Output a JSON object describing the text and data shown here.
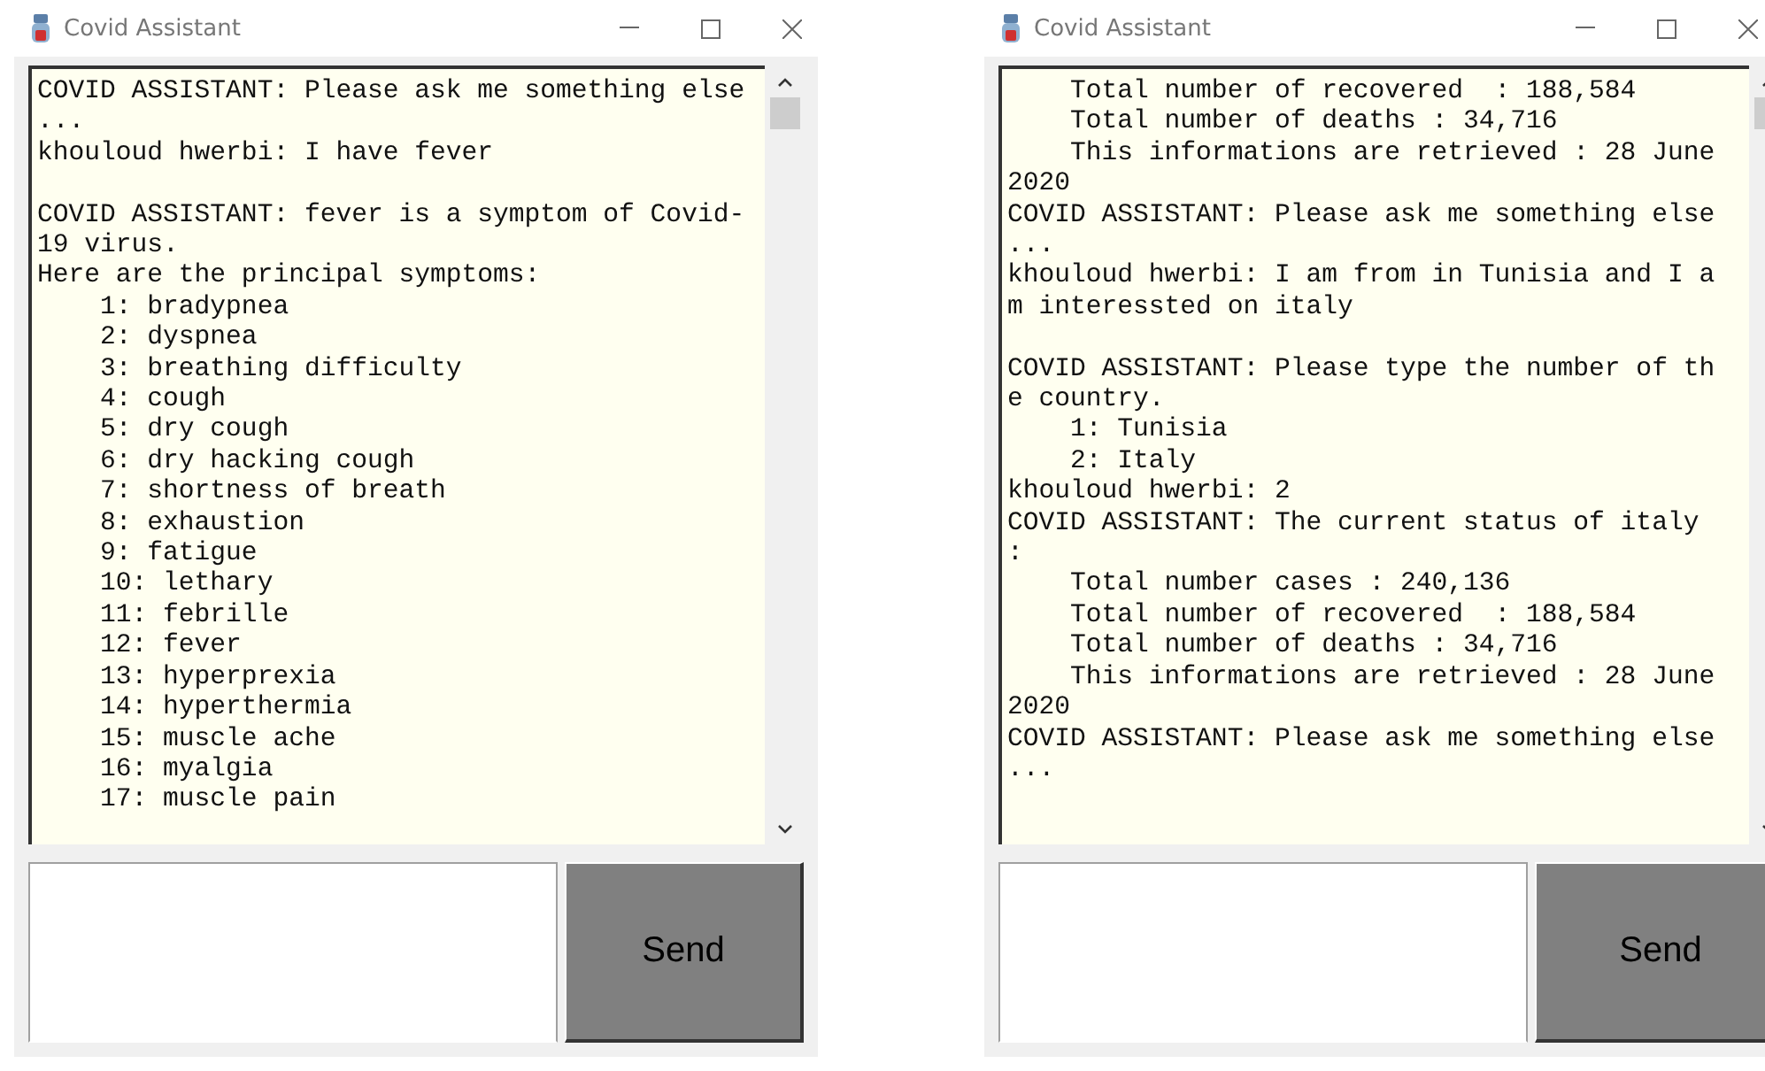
{
  "windows": [
    {
      "title": "Covid Assistant",
      "transcript": [
        {
          "text": "COVID ASSISTANT: Please ask me something else"
        },
        {
          "text": "..."
        },
        {
          "text": "khouloud hwerbi: I have fever"
        },
        {
          "text": "COVID ASSISTANT: fever is a symptom of Covid-",
          "space_before": true
        },
        {
          "text": "19 virus."
        },
        {
          "text": "Here are the principal symptoms:"
        },
        {
          "text": "    1: bradypnea"
        },
        {
          "text": "    2: dyspnea"
        },
        {
          "text": "    3: breathing difficulty"
        },
        {
          "text": "    4: cough"
        },
        {
          "text": "    5: dry cough"
        },
        {
          "text": "    6: dry hacking cough"
        },
        {
          "text": "    7: shortness of breath"
        },
        {
          "text": "    8: exhaustion"
        },
        {
          "text": "    9: fatigue"
        },
        {
          "text": "    10: lethary"
        },
        {
          "text": "    11: febrille"
        },
        {
          "text": "    12: fever"
        },
        {
          "text": "    13: hyperprexia"
        },
        {
          "text": "    14: hyperthermia"
        },
        {
          "text": "    15: muscle ache"
        },
        {
          "text": "    16: myalgia"
        },
        {
          "text": "    17: muscle pain"
        }
      ],
      "send_button": "Send"
    },
    {
      "title": "Covid Assistant",
      "transcript": [
        {
          "text": "    Total number of recovered  : 188,584"
        },
        {
          "text": "    Total number of deaths : 34,716"
        },
        {
          "text": "    This informations are retrieved : 28 June"
        },
        {
          "text": "2020"
        },
        {
          "text": "COVID ASSISTANT: Please ask me something else"
        },
        {
          "text": "..."
        },
        {
          "text": "khouloud hwerbi: I am from in Tunisia and I a"
        },
        {
          "text": "m interessted on italy"
        },
        {
          "text": "COVID ASSISTANT: Please type the number of th",
          "space_before": true
        },
        {
          "text": "e country."
        },
        {
          "text": "    1: Tunisia"
        },
        {
          "text": "    2: Italy"
        },
        {
          "text": "khouloud hwerbi: 2"
        },
        {
          "text": "COVID ASSISTANT: The current status of italy"
        },
        {
          "text": ":"
        },
        {
          "text": "    Total number cases : 240,136"
        },
        {
          "text": "    Total number of recovered  : 188,584"
        },
        {
          "text": "    Total number of deaths : 34,716"
        },
        {
          "text": "    This informations are retrieved : 28 June"
        },
        {
          "text": "2020"
        },
        {
          "text": "COVID ASSISTANT: Please ask me something else"
        },
        {
          "text": "..."
        }
      ],
      "send_button": "Send"
    }
  ]
}
